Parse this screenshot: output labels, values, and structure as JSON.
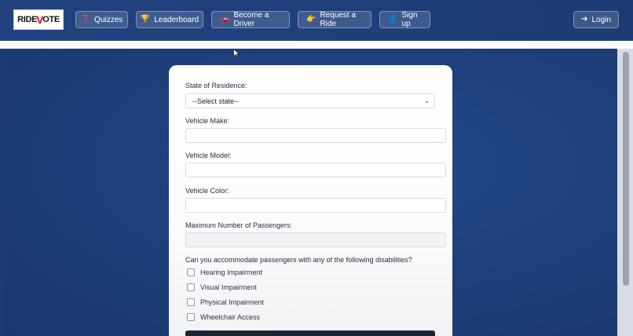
{
  "header": {
    "logo": {
      "part1": "RIDE",
      "part2": "V",
      "part3": "OTE"
    },
    "nav": [
      {
        "label": "Quizzes",
        "icon": "question-circle-icon"
      },
      {
        "label": "Leaderboard",
        "icon": "trophy-icon"
      },
      {
        "label": "Become a Driver",
        "icon": "car-icon"
      },
      {
        "label": "Request a Ride",
        "icon": "hand-pointing-icon"
      },
      {
        "label": "Sign up",
        "icon": "user-plus-icon"
      }
    ],
    "login": {
      "label": "Login",
      "icon": "sign-in-icon"
    }
  },
  "form": {
    "state_label": "State of Residence:",
    "state_value": "--Select state--",
    "make_label": "Vehicle Make:",
    "model_label": "Vehicle Model:",
    "color_label": "Vehicle Color:",
    "passengers_label": "Maximum Number of Passengers:",
    "disabilities_label": "Can you accommodate passengers with any of the following disabilities?",
    "options": [
      "Hearing Impairment",
      "Visual Impairment",
      "Physical Impairment",
      "Wheelchair Access"
    ]
  },
  "colors": {
    "brand_blue": "#1e3f7a",
    "logo_red": "#c8102e",
    "submit_dark": "#1b2635"
  }
}
